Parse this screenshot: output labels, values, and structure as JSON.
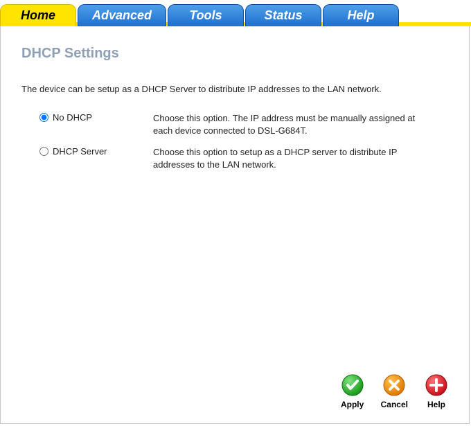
{
  "tabs": [
    {
      "label": "Home",
      "active": true
    },
    {
      "label": "Advanced",
      "active": false
    },
    {
      "label": "Tools",
      "active": false
    },
    {
      "label": "Status",
      "active": false
    },
    {
      "label": "Help",
      "active": false
    }
  ],
  "page": {
    "title": "DHCP Settings",
    "intro": "The device can be setup as a DHCP Server to distribute IP addresses to the LAN network."
  },
  "options": [
    {
      "value": "no-dhcp",
      "label": "No DHCP",
      "checked": true,
      "description": "Choose this option. The IP address must be manually assigned at each device connected to DSL-G684T."
    },
    {
      "value": "dhcp-server",
      "label": "DHCP Server",
      "checked": false,
      "description": "Choose this option to setup as a DHCP server to distribute IP addresses to the LAN network."
    }
  ],
  "actions": {
    "apply": "Apply",
    "cancel": "Cancel",
    "help": "Help"
  }
}
